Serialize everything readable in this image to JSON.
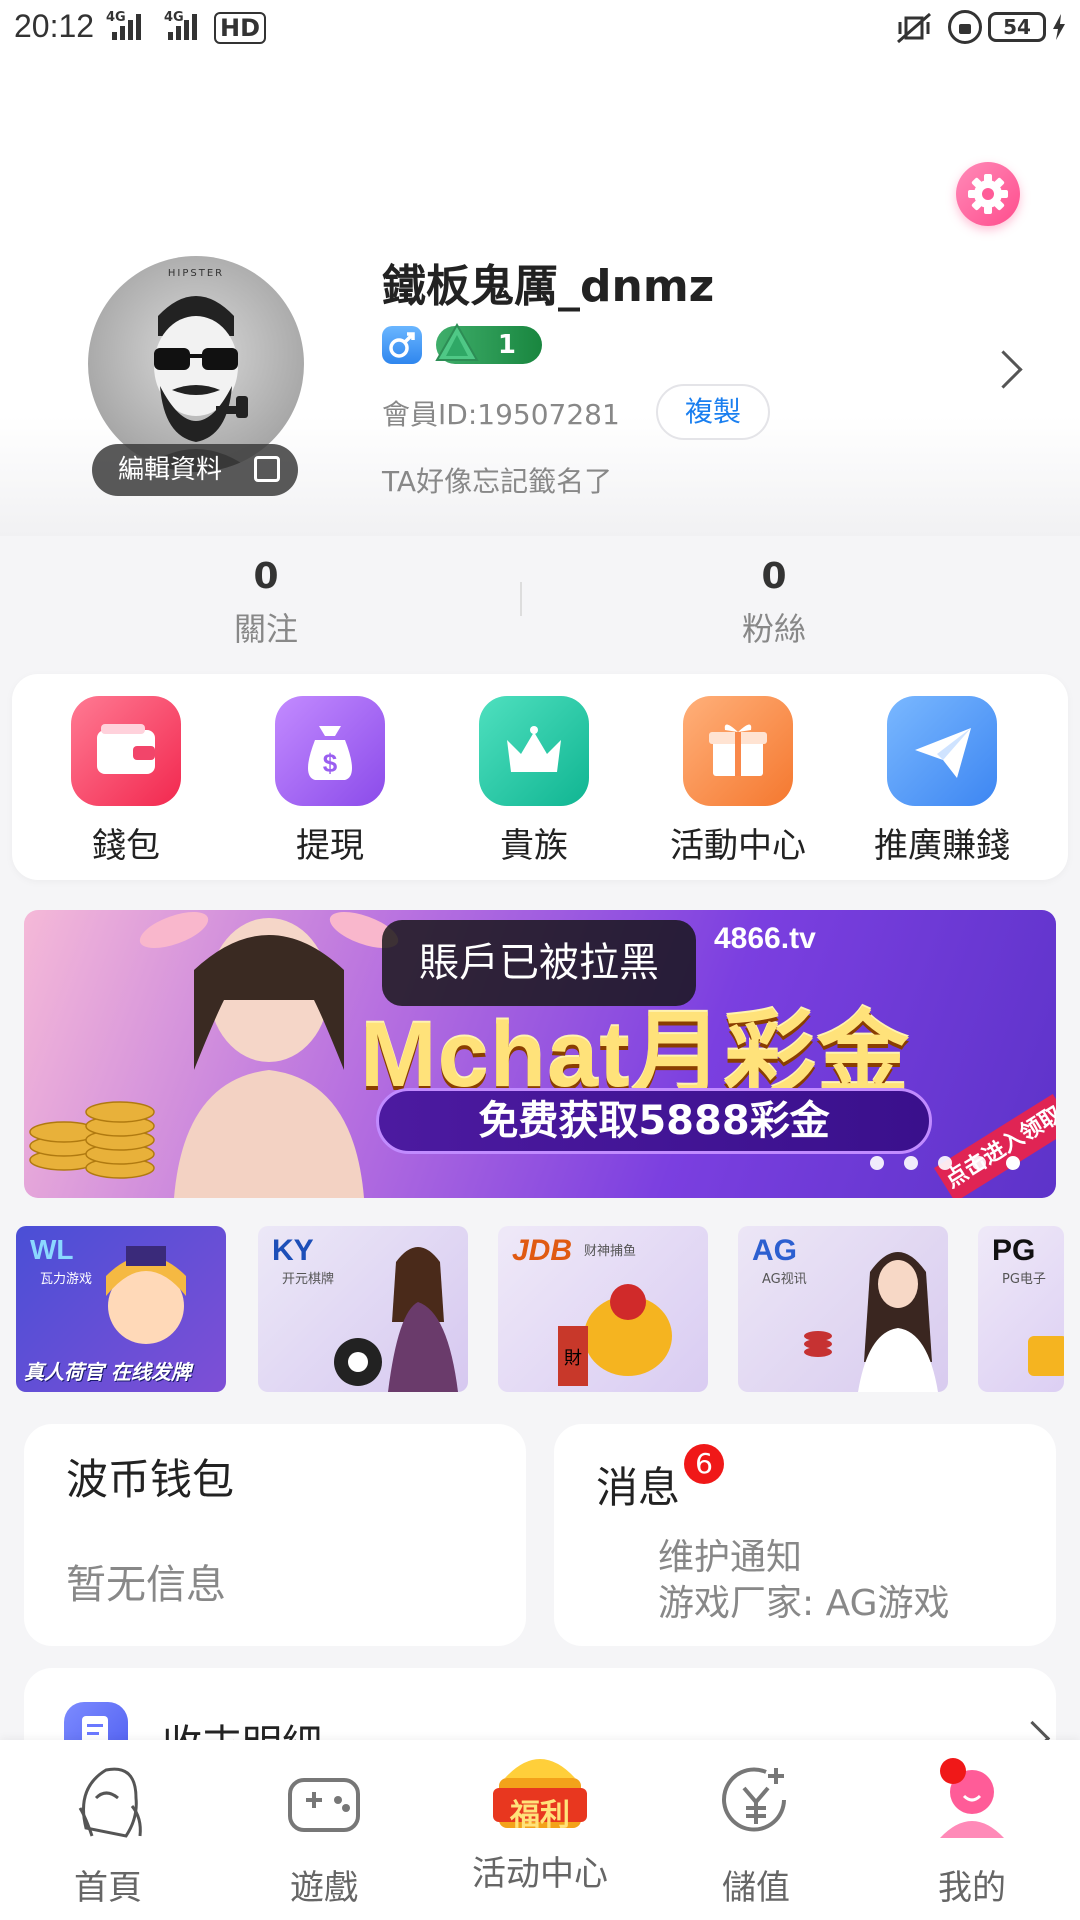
{
  "status_bar": {
    "time": "20:12",
    "network1": "4G",
    "network2": "4G",
    "hd": "HD",
    "battery": "54"
  },
  "profile": {
    "username": "鐵板鬼厲_dnmz",
    "edit_label": "編輯資料",
    "level": "1",
    "member_id": "會員ID:19507281",
    "copy_label": "複製",
    "signature": "TA好像忘記籤名了",
    "avatar_text": "HIPSTER"
  },
  "stats": {
    "following_count": "0",
    "following_label": "關注",
    "fans_count": "0",
    "fans_label": "粉絲"
  },
  "quick_menu": [
    {
      "label": "錢包",
      "icon": "wallet-icon",
      "color": "#f2456a"
    },
    {
      "label": "提現",
      "icon": "money-bag-icon",
      "color": "#a565f0"
    },
    {
      "label": "貴族",
      "icon": "crown-icon",
      "color": "#1cc9a6"
    },
    {
      "label": "活動中心",
      "icon": "gift-icon",
      "color": "#f9884a"
    },
    {
      "label": "推廣賺錢",
      "icon": "paper-plane-icon",
      "color": "#4d9cf6"
    }
  ],
  "banner": {
    "site": "4866.tv",
    "title": "Mchat月彩金",
    "subtitle": "免费获取5888彩金",
    "corner": "点击进入领取"
  },
  "toast": "賬戶已被拉黑",
  "games": [
    {
      "logo": "WL",
      "sub": "瓦力游戏",
      "caption": "真人荷官 在线发牌"
    },
    {
      "logo": "KY",
      "sub": "开元棋牌"
    },
    {
      "logo": "JDB",
      "sub": "财神捕鱼"
    },
    {
      "logo": "AG",
      "sub": "AG视讯"
    },
    {
      "logo": "PG",
      "sub": "PG电子"
    }
  ],
  "wallet_card": {
    "title": "波币钱包",
    "text": "暂无信息"
  },
  "message_card": {
    "title": "消息",
    "badge": "6",
    "line1": "维护通知",
    "line2": "游戏厂家: AG游戏"
  },
  "transactions": {
    "label": "收支明細"
  },
  "bottom_nav": [
    {
      "label": "首頁",
      "icon": "home-icon"
    },
    {
      "label": "遊戲",
      "icon": "gamepad-icon"
    },
    {
      "label": "活动中心",
      "icon": "welfare-icon",
      "badge_text": "福利"
    },
    {
      "label": "儲值",
      "icon": "recharge-icon"
    },
    {
      "label": "我的",
      "icon": "profile-icon"
    }
  ]
}
